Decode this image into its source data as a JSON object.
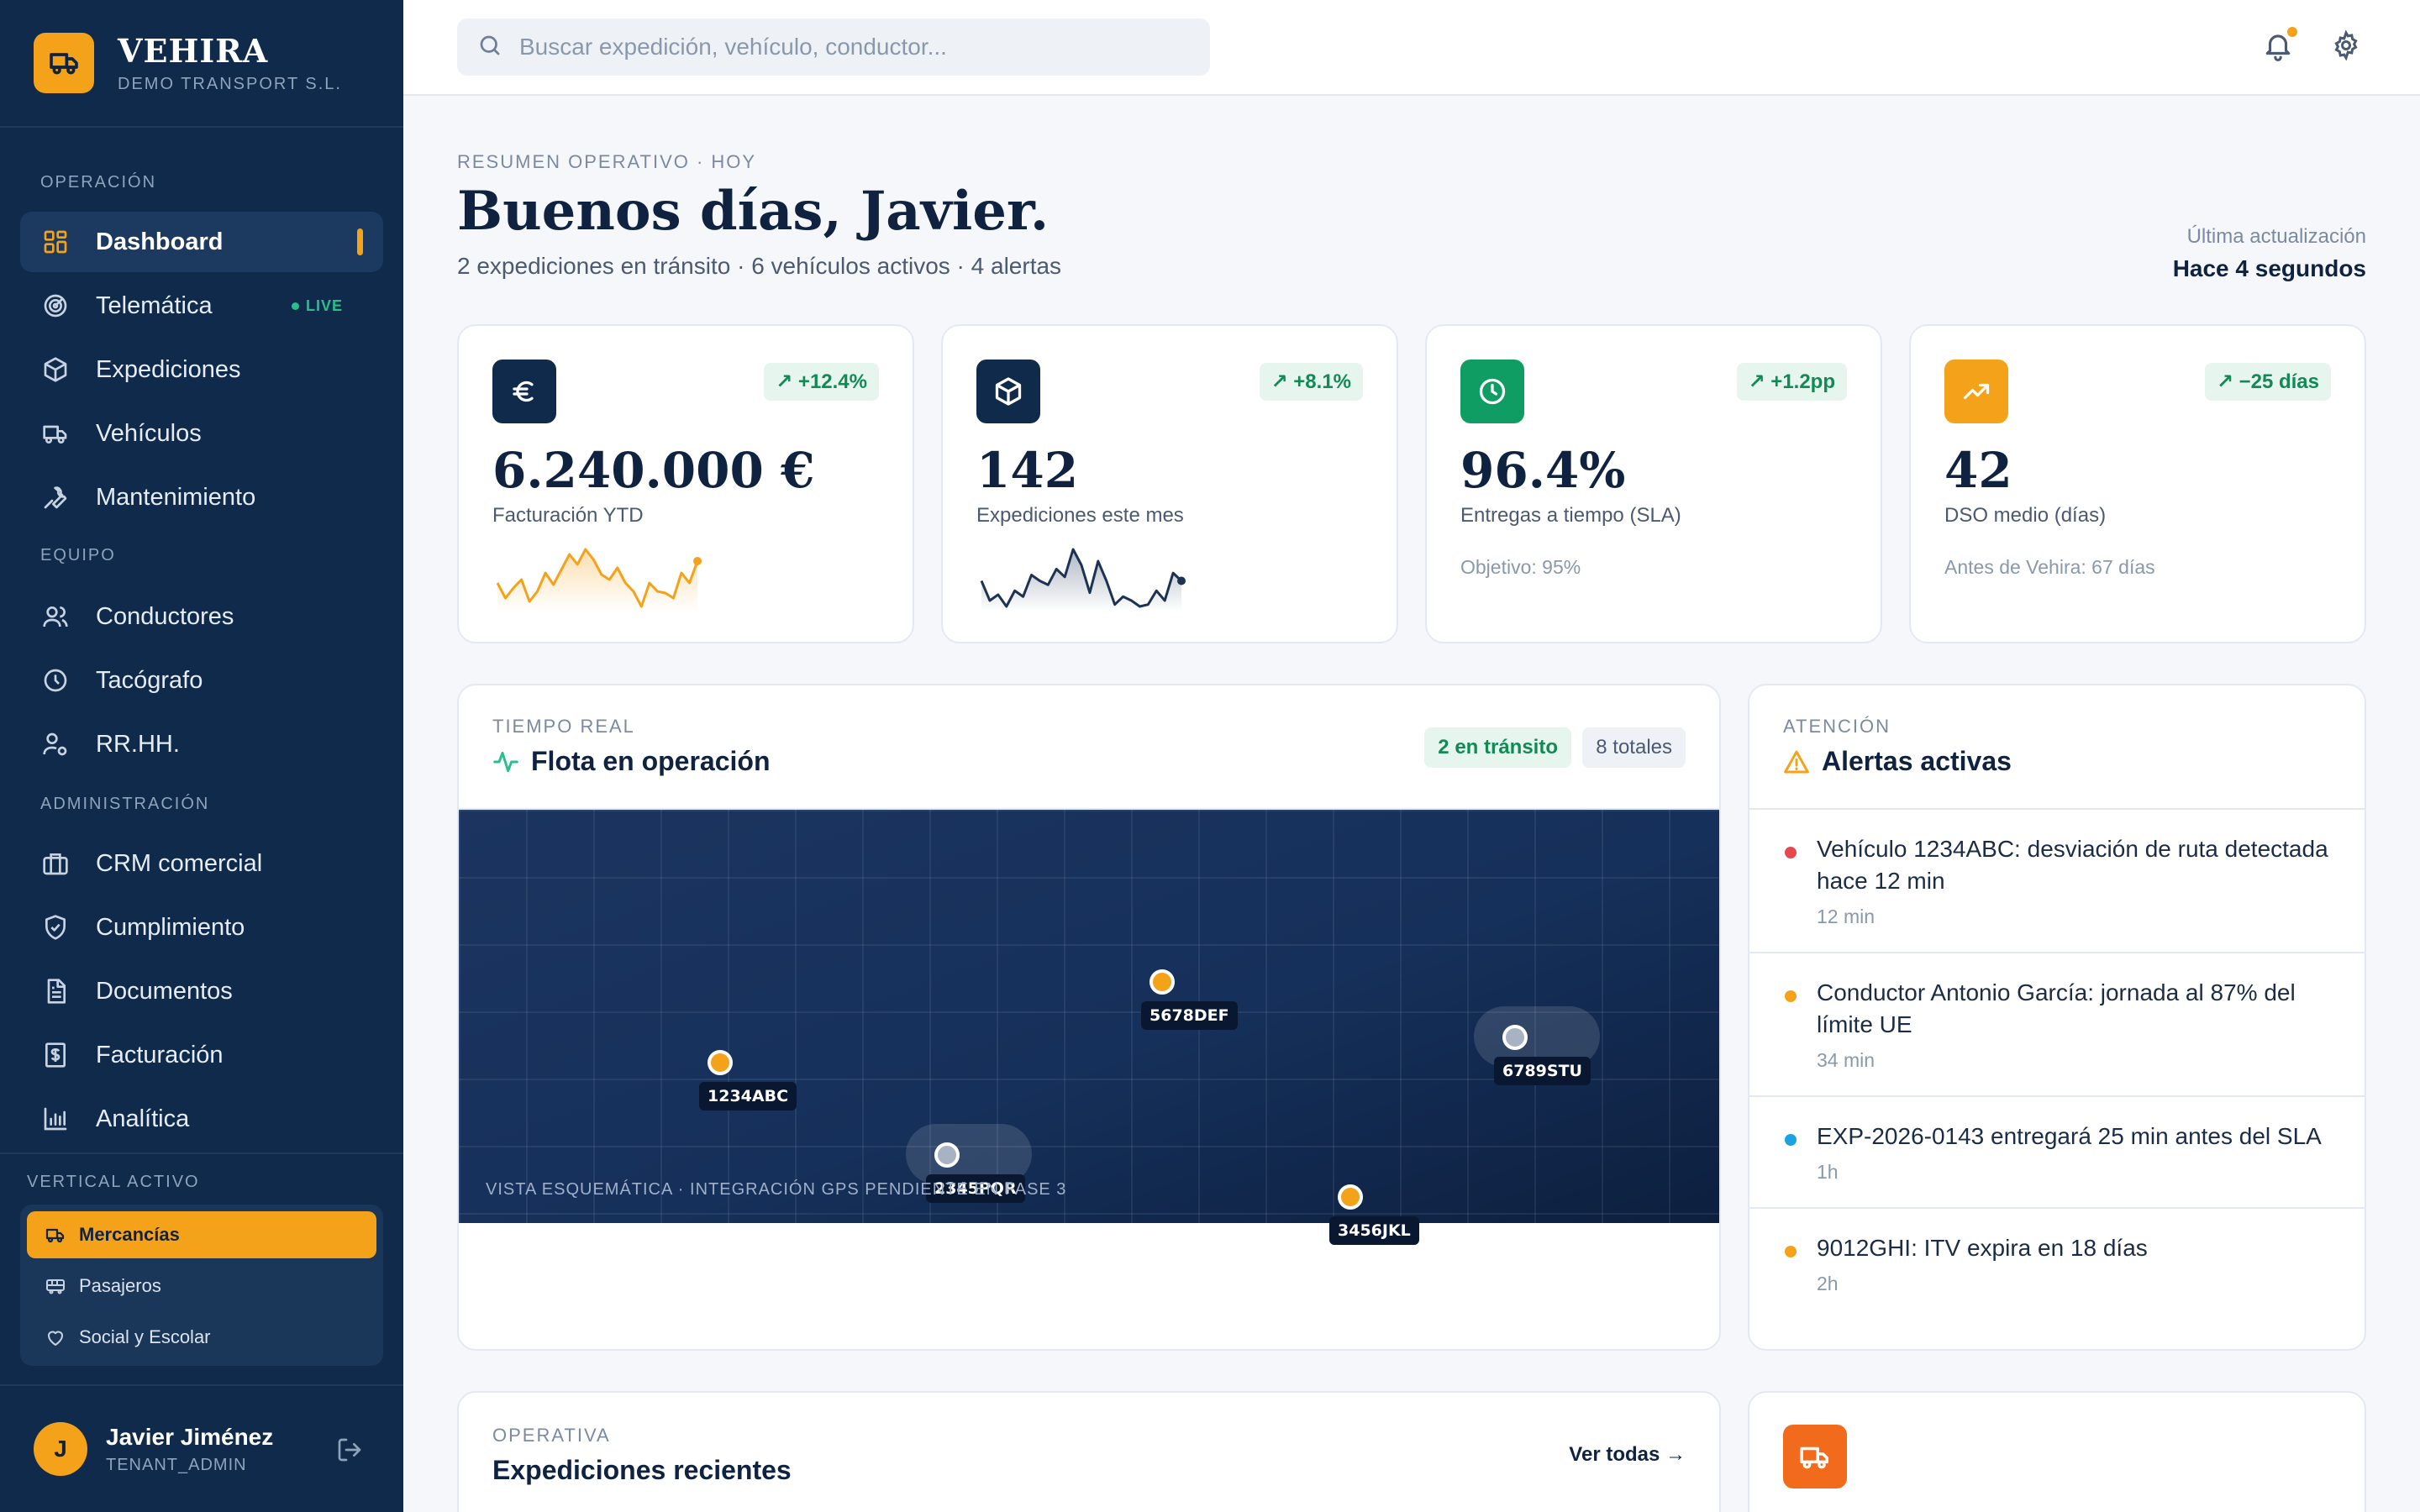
{
  "brand": {
    "name": "VEHIRA",
    "subtitle": "DEMO TRANSPORT S.L."
  },
  "nav": {
    "sections": {
      "operacion": "OPERACIÓN",
      "equipo": "EQUIPO",
      "administracion": "ADMINISTRACIÓN"
    },
    "items": [
      {
        "label": "Dashboard",
        "icon": "grid-icon"
      },
      {
        "label": "Telemática",
        "icon": "radar-icon",
        "badge": "LIVE"
      },
      {
        "label": "Expediciones",
        "icon": "package-icon"
      },
      {
        "label": "Vehículos",
        "icon": "truck-icon"
      },
      {
        "label": "Mantenimiento",
        "icon": "wrench-icon"
      },
      {
        "label": "Conductores",
        "icon": "users-icon"
      },
      {
        "label": "Tacógrafo",
        "icon": "clock-icon"
      },
      {
        "label": "RR.HH.",
        "icon": "user-cog-icon"
      },
      {
        "label": "CRM comercial",
        "icon": "briefcase-icon"
      },
      {
        "label": "Cumplimiento",
        "icon": "shield-check-icon"
      },
      {
        "label": "Documentos",
        "icon": "document-icon"
      },
      {
        "label": "Facturación",
        "icon": "invoice-icon"
      },
      {
        "label": "Analítica",
        "icon": "bar-chart-icon"
      }
    ]
  },
  "vertical": {
    "title": "VERTICAL ACTIVO",
    "items": [
      {
        "label": "Mercancías",
        "icon": "truck-icon"
      },
      {
        "label": "Pasajeros",
        "icon": "bus-icon"
      },
      {
        "label": "Social y Escolar",
        "icon": "heart-icon"
      }
    ]
  },
  "user": {
    "initial": "J",
    "name": "Javier Jiménez",
    "role": "TENANT_ADMIN"
  },
  "search": {
    "placeholder": "Buscar expedición, vehículo, conductor..."
  },
  "header": {
    "eyebrow": "RESUMEN OPERATIVO · HOY",
    "greeting": "Buenos días, Javier.",
    "subtitle": "2 expediciones en tránsito · 6 vehículos activos · 4 alertas",
    "updated_label": "Última actualización",
    "updated_value": "Hace 4 segundos"
  },
  "kpis": [
    {
      "value": "6.240.000 €",
      "label": "Facturación YTD",
      "delta": "+12.4%",
      "icon": "euro-icon",
      "icon_bg": "#0f2a4a",
      "spark": [
        40,
        22,
        34,
        44,
        18,
        30,
        52,
        38,
        56,
        74,
        62,
        80,
        68,
        50,
        44,
        58,
        40,
        30,
        12,
        40,
        30,
        28,
        22,
        52,
        40,
        66
      ]
    },
    {
      "value": "142",
      "label": "Expediciones este mes",
      "delta": "+8.1%",
      "icon": "box-icon",
      "icon_bg": "#0f2a4a",
      "spark": [
        40,
        20,
        26,
        14,
        30,
        24,
        46,
        40,
        36,
        52,
        44,
        72,
        56,
        28,
        60,
        40,
        16,
        24,
        20,
        14,
        16,
        30,
        20,
        48,
        40
      ]
    },
    {
      "value": "96.4%",
      "label": "Entregas a tiempo (SLA)",
      "delta": "+1.2pp",
      "icon": "clock-icon",
      "icon_bg": "#0f9d63",
      "note": "Objetivo: 95%"
    },
    {
      "value": "42",
      "label": "DSO medio (días)",
      "delta": "−25 días",
      "icon": "trend-up-icon",
      "icon_bg": "#f5a21b",
      "note": "Antes de Vehira: 67 días"
    }
  ],
  "fleet": {
    "eyebrow": "TIEMPO REAL",
    "title": "Flota en operación",
    "chip_transit": "2 en tránsito",
    "chip_total": "8 totales",
    "vehicles": [
      {
        "plate": "1234ABC",
        "status": "transit"
      },
      {
        "plate": "5678DEF",
        "status": "transit"
      },
      {
        "plate": "2345PQR",
        "status": "idle"
      },
      {
        "plate": "6789STU",
        "status": "idle"
      },
      {
        "plate": "3456JKL",
        "status": "transit"
      }
    ],
    "caption": "VISTA ESQUEMÁTICA · INTEGRACIÓN GPS PENDIENTE EN FASE 3"
  },
  "alerts": {
    "eyebrow": "ATENCIÓN",
    "title": "Alertas activas",
    "items": [
      {
        "text": "Vehículo 1234ABC: desviación de ruta detectada hace 12 min",
        "time": "12 min",
        "color": "#e5484d"
      },
      {
        "text": "Conductor Antonio García: jornada al 87% del límite UE",
        "time": "34 min",
        "color": "#f5a21b"
      },
      {
        "text": "EXP-2026-0143 entregará 25 min antes del SLA",
        "time": "1h",
        "color": "#1ba3e0"
      },
      {
        "text": "9012GHI: ITV expira en 18 días",
        "time": "2h",
        "color": "#f5a21b"
      }
    ]
  },
  "recent": {
    "eyebrow": "OPERATIVA",
    "title": "Expediciones recientes",
    "link": "Ver todas →"
  },
  "colors": {
    "accent": "#f5a21b",
    "navy": "#0f2a4a",
    "success": "#0f9d63",
    "danger": "#e5484d",
    "info": "#1ba3e0"
  }
}
